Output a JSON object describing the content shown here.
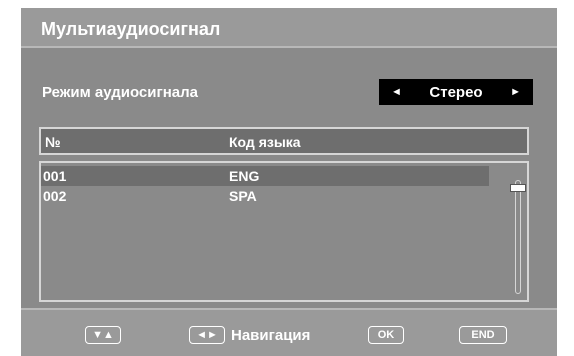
{
  "osd": {
    "title": "Мультиаудиосигнал",
    "audio_mode": {
      "label": "Режим аудиосигнала",
      "value": "Стерео",
      "left_arrow": "◄",
      "right_arrow": "►"
    },
    "table": {
      "columns": [
        "№",
        "Код языка"
      ],
      "rows": [
        {
          "no": "001",
          "lang": "ENG",
          "selected": true
        },
        {
          "no": "002",
          "lang": "SPA",
          "selected": false
        }
      ]
    },
    "footer": {
      "updown_key": "▼▲",
      "leftright_key": "◄►",
      "navigation_label": "Навигация",
      "ok_key": "OK",
      "end_key": "END"
    },
    "colors": {
      "frame": "#9a9a9a",
      "panel": "#8a8a8a",
      "header_row": "#6e6e6e",
      "selector_bg": "#000000",
      "text": "#ffffff"
    }
  }
}
